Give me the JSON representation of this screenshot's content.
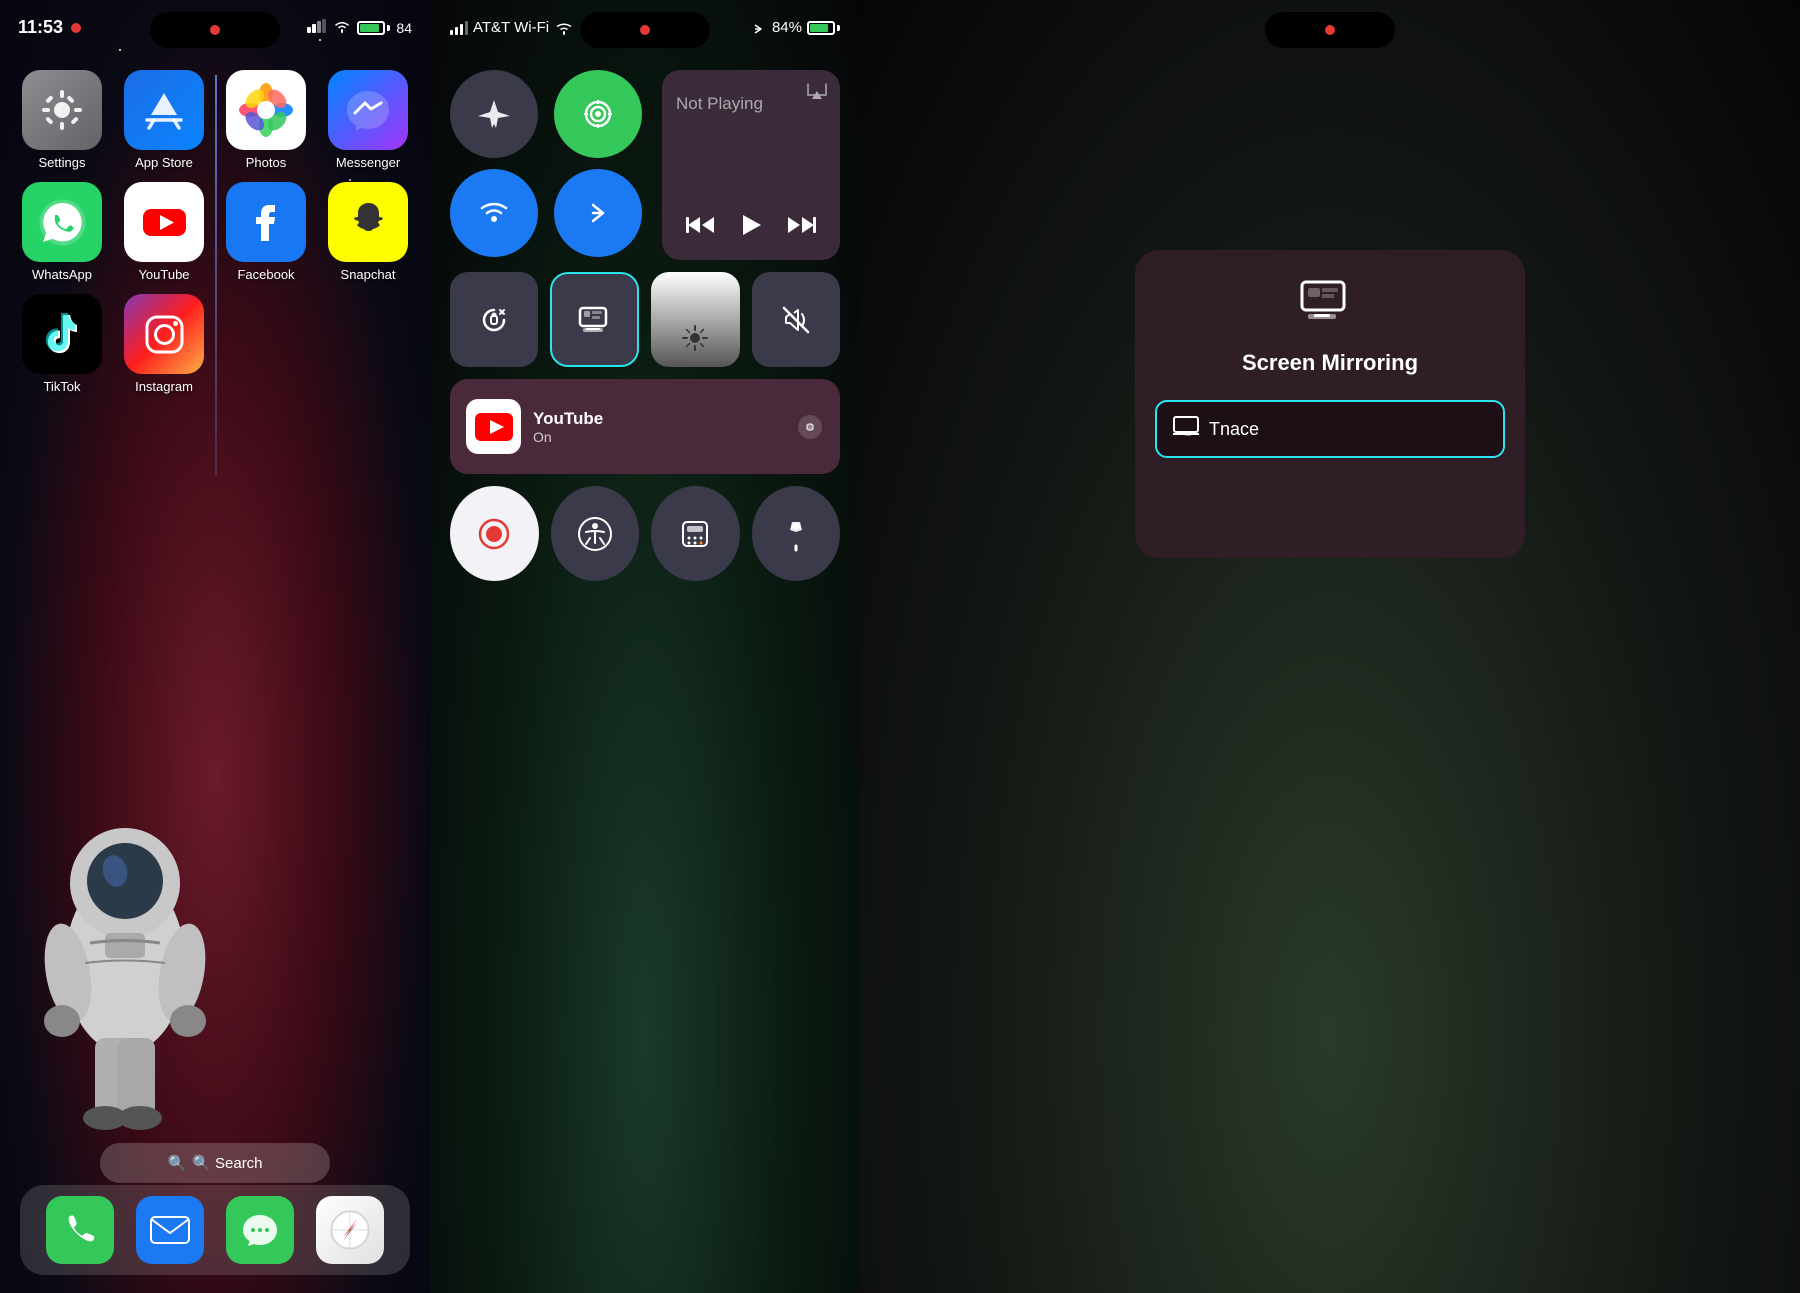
{
  "panel_home": {
    "status": {
      "time": "11:53",
      "signal": "●●",
      "wifi": "WiFi",
      "battery": "84"
    },
    "apps": [
      {
        "id": "settings",
        "label": "Settings",
        "icon": "⚙️",
        "class": "icon-settings"
      },
      {
        "id": "appstore",
        "label": "App Store",
        "icon": "🅰",
        "class": "icon-appstore"
      },
      {
        "id": "photos",
        "label": "Photos",
        "icon": "🌸",
        "class": "icon-photos"
      },
      {
        "id": "messenger",
        "label": "Messenger",
        "icon": "💬",
        "class": "icon-messenger"
      },
      {
        "id": "whatsapp",
        "label": "WhatsApp",
        "icon": "📞",
        "class": "icon-whatsapp"
      },
      {
        "id": "youtube",
        "label": "YouTube",
        "icon": "▶",
        "class": "icon-youtube"
      },
      {
        "id": "facebook",
        "label": "Facebook",
        "icon": "f",
        "class": "icon-facebook"
      },
      {
        "id": "snapchat",
        "label": "Snapchat",
        "icon": "👻",
        "class": "icon-snapchat"
      },
      {
        "id": "tiktok",
        "label": "TikTok",
        "icon": "♪",
        "class": "icon-tiktok"
      },
      {
        "id": "instagram",
        "label": "Instagram",
        "icon": "📷",
        "class": "icon-instagram"
      }
    ],
    "search_label": "🔍 Search",
    "dock": [
      {
        "id": "phone",
        "label": "Phone",
        "class": "icon-phone",
        "icon": "📞"
      },
      {
        "id": "mail",
        "label": "Mail",
        "class": "icon-mail",
        "icon": "✉️"
      },
      {
        "id": "messages",
        "label": "Messages",
        "class": "icon-messages",
        "icon": "💬"
      },
      {
        "id": "safari",
        "label": "Safari",
        "class": "icon-safari",
        "icon": "🧭"
      }
    ]
  },
  "panel_cc": {
    "carrier": "AT&T Wi-Fi",
    "battery": "84%",
    "toggles": {
      "airplane": {
        "icon": "✈️",
        "label": "Airplane",
        "active": false
      },
      "cellular": {
        "icon": "📡",
        "label": "Cellular",
        "active": true
      },
      "wifi": {
        "icon": "WiFi",
        "label": "Wi-Fi",
        "active": true
      },
      "bluetooth": {
        "icon": "BT",
        "label": "Bluetooth",
        "active": true
      }
    },
    "media": {
      "title": "Not Playing",
      "prev": "⏮",
      "play": "▶",
      "next": "⏭"
    },
    "screen_mirror_label": "Screen Mirror",
    "brightness_label": "Brightness",
    "mute_label": "Mute",
    "youtube_widget": {
      "name": "YouTube",
      "status": "On"
    },
    "bottom_buttons": {
      "record": "⏺",
      "accessibility": "♿",
      "calculator": "⌨",
      "flashlight": "🔦"
    }
  },
  "panel_mirror": {
    "title": "Screen Mirroring",
    "device": "Tnace",
    "device_icon": "💻"
  }
}
